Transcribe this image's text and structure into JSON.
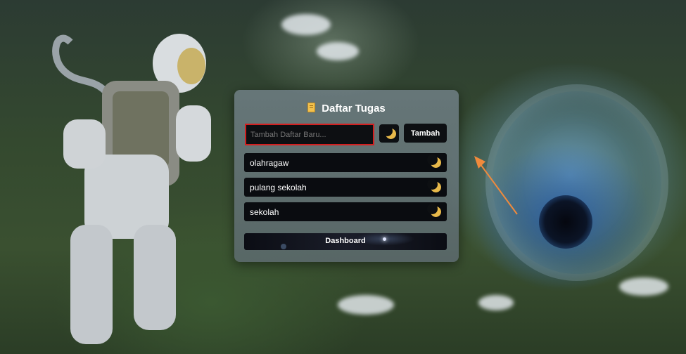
{
  "app": {
    "title": "Daftar Tugas",
    "title_icon": "clipboard-icon"
  },
  "form": {
    "placeholder": "Tambah Daftar Baru...",
    "value": "",
    "theme_toggle_icon": "moon-icon",
    "add_label": "Tambah"
  },
  "tasks": [
    {
      "label": "olahragaw",
      "icon": "moon-icon"
    },
    {
      "label": "pulang sekolah",
      "icon": "moon-icon"
    },
    {
      "label": "sekolah",
      "icon": "moon-icon"
    }
  ],
  "footer": {
    "dashboard_label": "Dashboard"
  },
  "colors": {
    "accent_moon": "#e8b94a",
    "input_border": "#d41f1f",
    "button_bg": "#0d0f12"
  }
}
